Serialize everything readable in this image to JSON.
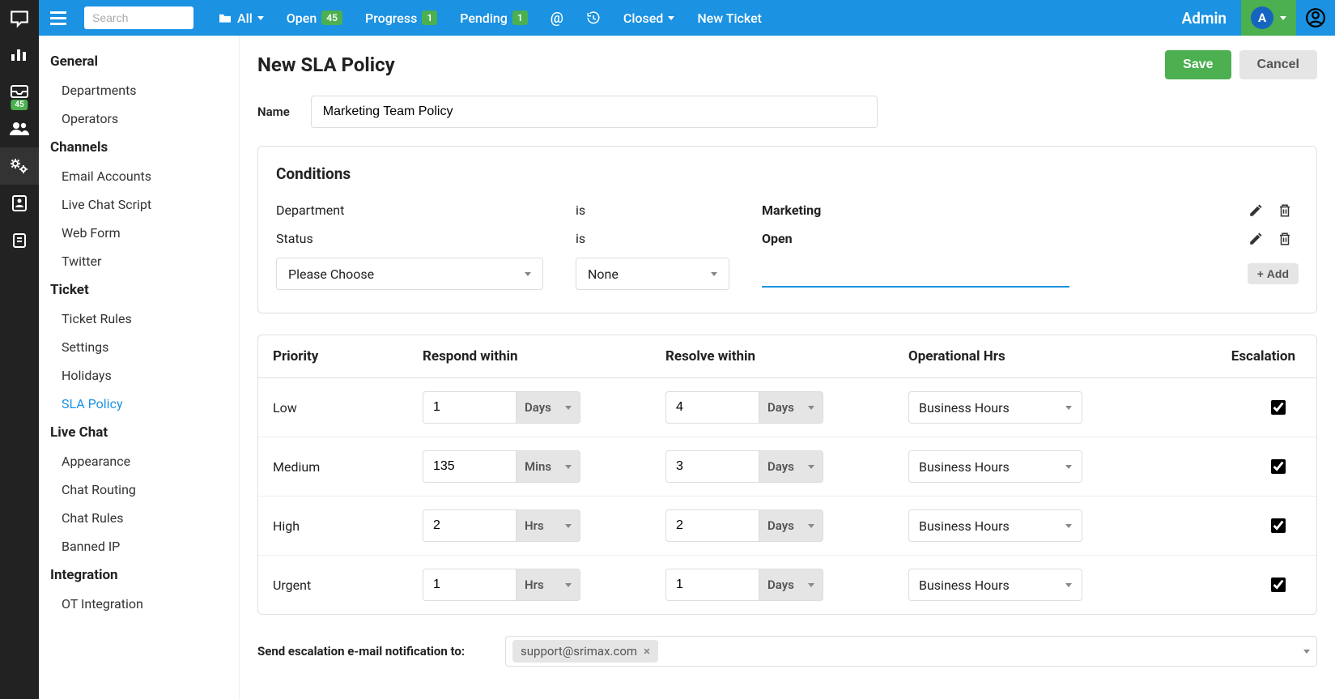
{
  "topbar": {
    "search_placeholder": "Search",
    "all_label": "All",
    "open_label": "Open",
    "open_count": "45",
    "progress_label": "Progress",
    "progress_count": "1",
    "pending_label": "Pending",
    "pending_count": "1",
    "closed_label": "Closed",
    "new_ticket_label": "New Ticket",
    "admin_label": "Admin",
    "avatar_letter": "A"
  },
  "rail": {
    "badge_count": "45"
  },
  "sidebar": {
    "general": "General",
    "departments": "Departments",
    "operators": "Operators",
    "channels": "Channels",
    "email_accounts": "Email Accounts",
    "live_chat_script": "Live Chat Script",
    "web_form": "Web Form",
    "twitter": "Twitter",
    "ticket": "Ticket",
    "ticket_rules": "Ticket Rules",
    "settings": "Settings",
    "holidays": "Holidays",
    "sla_policy": "SLA Policy",
    "live_chat": "Live Chat",
    "appearance": "Appearance",
    "chat_routing": "Chat Routing",
    "chat_rules": "Chat Rules",
    "banned_ip": "Banned IP",
    "integration": "Integration",
    "ot_integration": "OT Integration"
  },
  "page": {
    "title": "New SLA Policy",
    "save": "Save",
    "cancel": "Cancel",
    "name_label": "Name",
    "name_value": "Marketing Team Policy"
  },
  "conditions": {
    "title": "Conditions",
    "rows": [
      {
        "field": "Department",
        "op": "is",
        "value": "Marketing"
      },
      {
        "field": "Status",
        "op": "is",
        "value": "Open"
      }
    ],
    "choose_placeholder": "Please Choose",
    "none_placeholder": "None",
    "add_label": "Add"
  },
  "priority_table": {
    "headers": {
      "priority": "Priority",
      "respond": "Respond within",
      "resolve": "Resolve within",
      "ophrs": "Operational Hrs",
      "escalation": "Escalation"
    },
    "rows": [
      {
        "priority": "Low",
        "respond_val": "1",
        "respond_unit": "Days",
        "resolve_val": "4",
        "resolve_unit": "Days",
        "ophrs": "Business Hours",
        "escalation": true
      },
      {
        "priority": "Medium",
        "respond_val": "135",
        "respond_unit": "Mins",
        "resolve_val": "3",
        "resolve_unit": "Days",
        "ophrs": "Business Hours",
        "escalation": true
      },
      {
        "priority": "High",
        "respond_val": "2",
        "respond_unit": "Hrs",
        "resolve_val": "2",
        "resolve_unit": "Days",
        "ophrs": "Business Hours",
        "escalation": true
      },
      {
        "priority": "Urgent",
        "respond_val": "1",
        "respond_unit": "Hrs",
        "resolve_val": "1",
        "resolve_unit": "Days",
        "ophrs": "Business Hours",
        "escalation": true
      }
    ]
  },
  "escalation_email": {
    "label": "Send escalation e-mail notification to:",
    "chip": "support@srimax.com"
  }
}
